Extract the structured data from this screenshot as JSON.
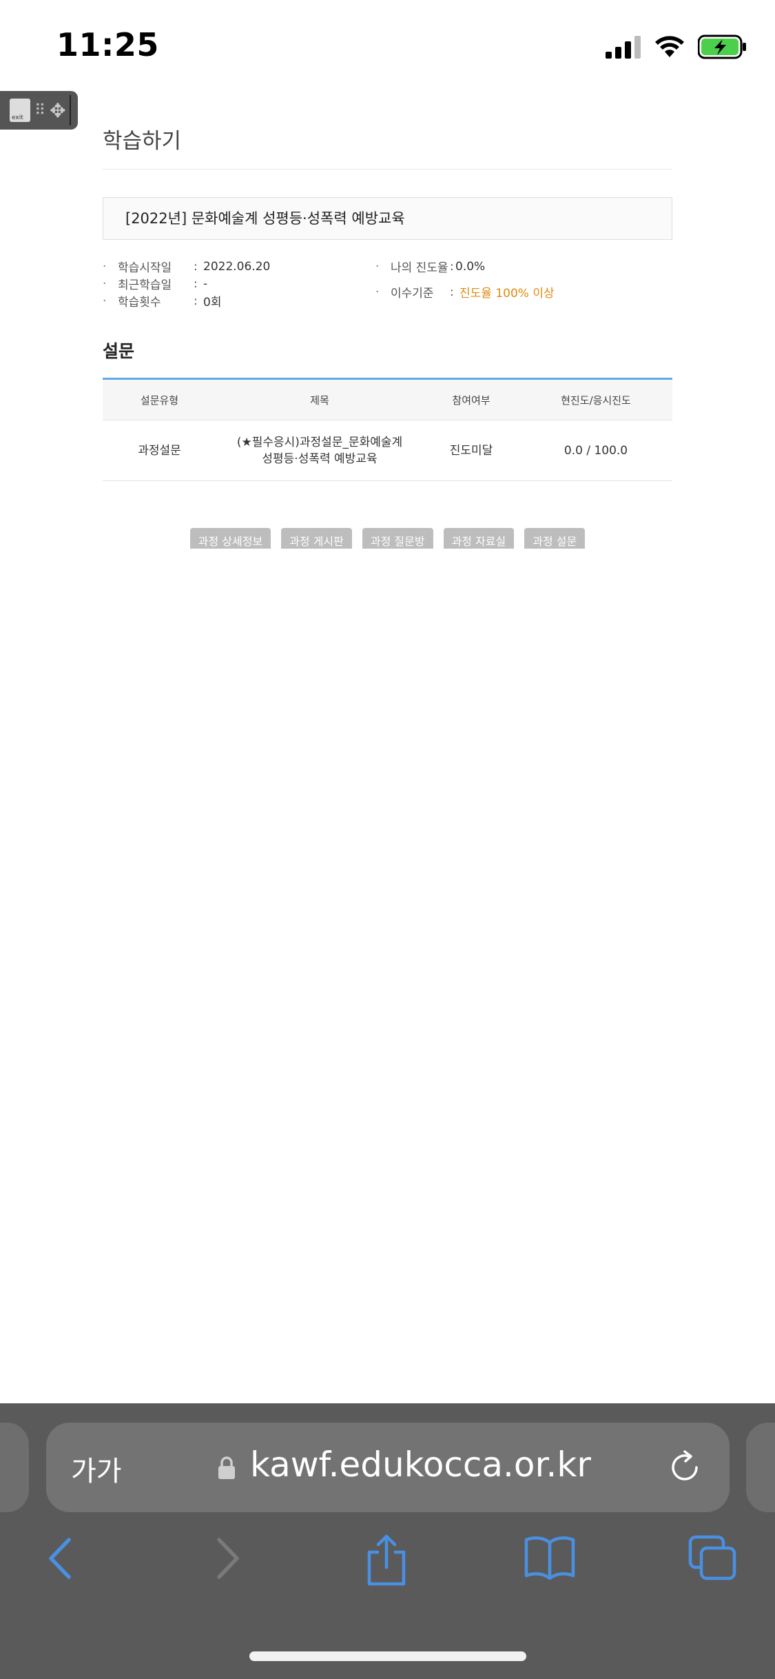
{
  "status_bar": {
    "time": "11:25"
  },
  "floating_tool": {
    "exit_label": "exit"
  },
  "page": {
    "title": "학습하기"
  },
  "course": {
    "name": "[2022년] 문화예술계 성평등·성폭력 예방교육"
  },
  "info": {
    "start_label": "학습시작일",
    "start_value": "2022.06.20",
    "recent_label": "최근학습일",
    "recent_value": "-",
    "count_label": "학습횟수",
    "count_value": "0회",
    "progress_label": "나의 진도율",
    "progress_value": "0.0%",
    "criteria_label": "이수기준",
    "criteria_value": "진도율 100% 이상"
  },
  "survey": {
    "section_title": "설문",
    "headers": [
      "설문유형",
      "제목",
      "참여여부",
      "현진도/응시진도"
    ],
    "row": {
      "type": "과정설문",
      "title_line1": "(★필수응시)과정설문_문화예술계",
      "title_line2": "성평등·성폭력 예방교육",
      "status": "진도미달",
      "progress": "0.0 / 100.0"
    }
  },
  "buttons": [
    "과정 상세정보",
    "과정 게시판",
    "과정 질문방",
    "과정 자료실",
    "과정 설문"
  ],
  "browser": {
    "text_size": "가가",
    "url": "kawf.edukocca.or.kr"
  },
  "colors": {
    "accent_blue": "#62a9e8",
    "criteria_orange": "#e08a10",
    "safari_icon_blue": "#4a90e2"
  }
}
